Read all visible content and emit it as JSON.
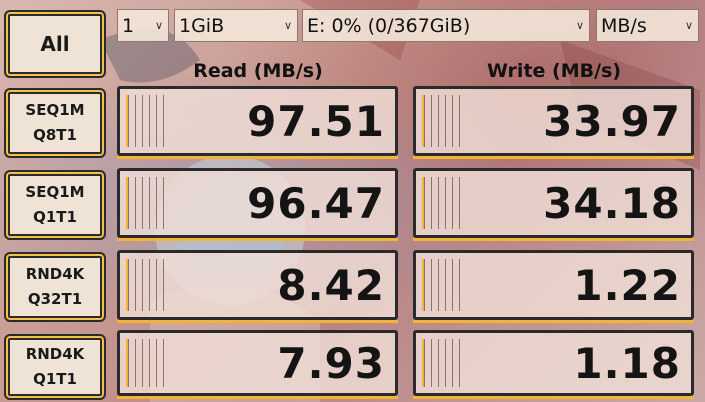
{
  "controls": {
    "count": "1",
    "size": "1GiB",
    "drive": "E: 0% (0/367GiB)",
    "unit": "MB/s"
  },
  "all_button": "All",
  "headers": {
    "read": "Read (MB/s)",
    "write": "Write (MB/s)"
  },
  "tests": [
    {
      "line1": "SEQ1M",
      "line2": "Q8T1",
      "read": "97.51",
      "write": "33.97"
    },
    {
      "line1": "SEQ1M",
      "line2": "Q1T1",
      "read": "96.47",
      "write": "34.18"
    },
    {
      "line1": "RND4K",
      "line2": "Q32T1",
      "read": "8.42",
      "write": "1.22"
    },
    {
      "line1": "RND4K",
      "line2": "Q1T1",
      "read": "7.93",
      "write": "1.18"
    }
  ],
  "colors": {
    "accent": "#f2b437",
    "frame": "#2a2a2a"
  }
}
